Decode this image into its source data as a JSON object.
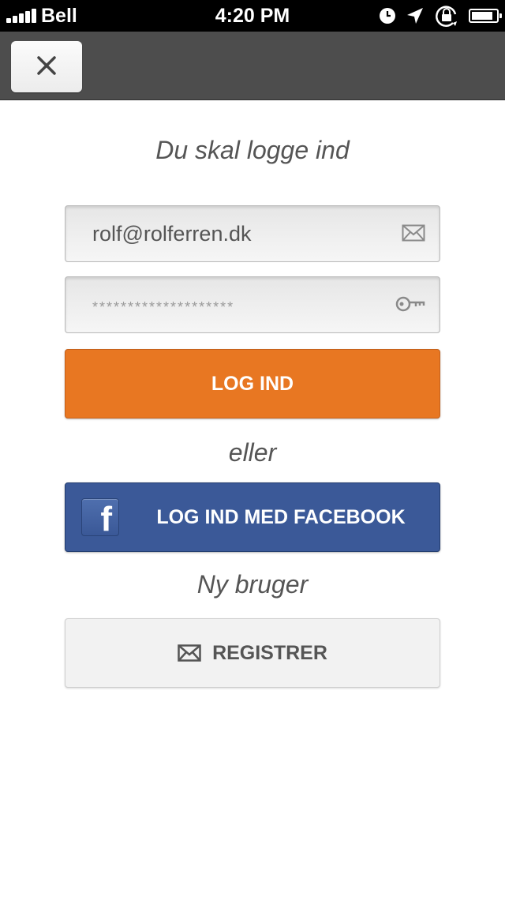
{
  "status_bar": {
    "carrier": "Bell",
    "time": "4:20 PM",
    "icons": [
      "signal-icon",
      "clock-icon",
      "location-arrow-icon",
      "rotation-lock-icon",
      "battery-icon"
    ],
    "battery_level": 0.85
  },
  "nav": {
    "close_icon": "close-icon"
  },
  "login": {
    "heading": "Du skal logge ind",
    "email_value": "rolf@rolferren.dk",
    "password_placeholder": "********************",
    "email_icon": "envelope-icon",
    "password_icon": "key-icon",
    "login_button": "LOG IND",
    "or_text": "eller",
    "facebook_button": "LOG IND MED FACEBOOK",
    "facebook_icon": "facebook-icon",
    "new_user_text": "Ny bruger",
    "register_button": "REGISTRER",
    "register_icon": "envelope-icon"
  },
  "colors": {
    "login_button": "#e87722",
    "facebook_button": "#3b5998",
    "nav_bar": "#4d4d4d"
  }
}
